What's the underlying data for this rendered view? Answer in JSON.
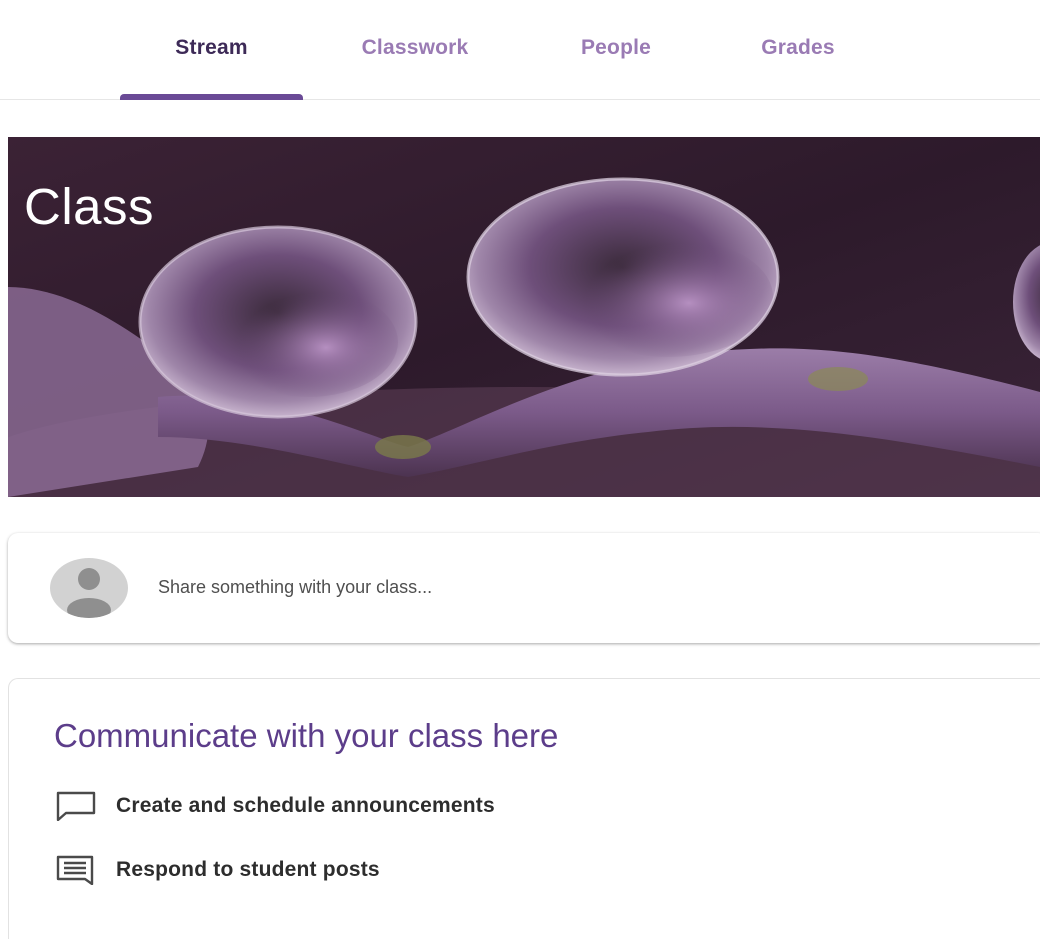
{
  "tabs": [
    {
      "label": "Stream",
      "active": true
    },
    {
      "label": "Classwork",
      "active": false
    },
    {
      "label": "People",
      "active": false
    },
    {
      "label": "Grades",
      "active": false
    }
  ],
  "banner": {
    "title": "Class"
  },
  "share": {
    "prompt": "Share something with your class..."
  },
  "communicate": {
    "heading": "Communicate with your class here",
    "items": [
      {
        "label": "Create and schedule announcements",
        "icon": "comment-outline-icon"
      },
      {
        "label": "Respond to student posts",
        "icon": "message-lines-icon"
      }
    ]
  },
  "colors": {
    "accent": "#6a4a96",
    "heading": "#5c3d8a",
    "tab_inactive": "#9a7bb4",
    "tab_active": "#3d2a57"
  }
}
